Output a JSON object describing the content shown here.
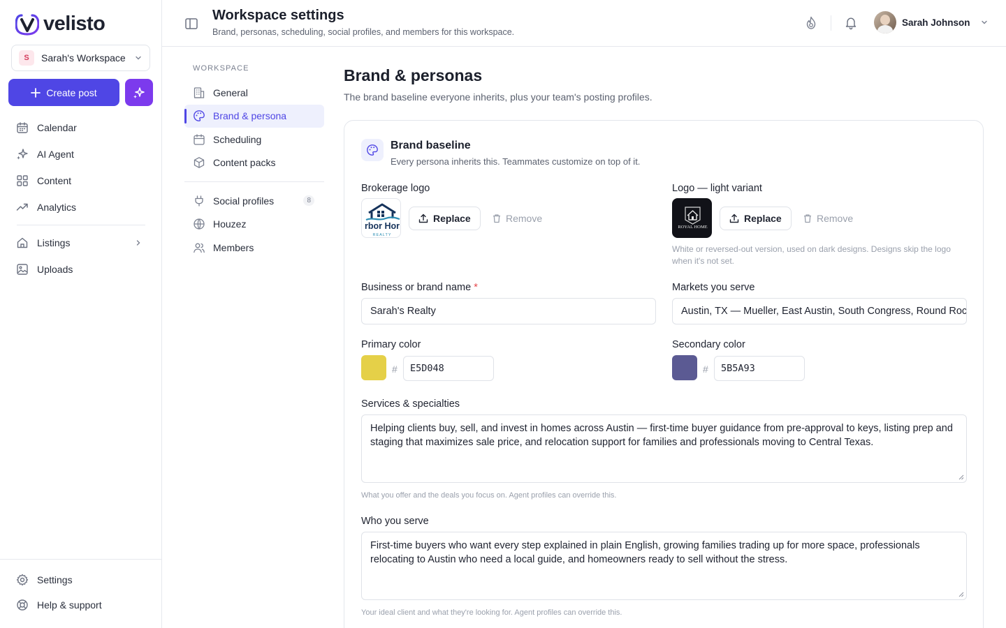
{
  "app": {
    "name": "velisto"
  },
  "workspace_switcher": {
    "initial": "S",
    "name": "Sarah's Workspace"
  },
  "actions": {
    "create_post": "Create post"
  },
  "nav": [
    {
      "label": "Calendar",
      "icon": "calendar-icon"
    },
    {
      "label": "AI Agent",
      "icon": "sparkles-icon"
    },
    {
      "label": "Content",
      "icon": "grid-icon"
    },
    {
      "label": "Analytics",
      "icon": "trend-icon"
    },
    {
      "label": "Listings",
      "icon": "home-icon"
    },
    {
      "label": "Uploads",
      "icon": "image-icon"
    }
  ],
  "nav_bottom": [
    {
      "label": "Settings",
      "icon": "gear-icon"
    },
    {
      "label": "Help & support",
      "icon": "lifebuoy-icon"
    }
  ],
  "header": {
    "title": "Workspace settings",
    "subtitle": "Brand, personas, scheduling, social profiles, and members for this workspace.",
    "user_name": "Sarah Johnson"
  },
  "subnav": {
    "heading": "WORKSPACE",
    "items": [
      {
        "label": "General",
        "icon": "building-icon"
      },
      {
        "label": "Brand & persona",
        "icon": "palette-icon",
        "active": true
      },
      {
        "label": "Scheduling",
        "icon": "calendar-icon"
      },
      {
        "label": "Content packs",
        "icon": "box-icon"
      }
    ],
    "items2": [
      {
        "label": "Social profiles",
        "icon": "plug-icon",
        "count": "8"
      },
      {
        "label": "Houzez",
        "icon": "globe-icon"
      },
      {
        "label": "Members",
        "icon": "users-icon"
      }
    ]
  },
  "main": {
    "title": "Brand & personas",
    "subtitle": "The brand baseline everyone inherits, plus your team's posting profiles."
  },
  "card": {
    "title": "Brand baseline",
    "subtitle": "Every persona inherits this. Teammates customize on top of it.",
    "brokerage_logo": {
      "label": "Brokerage logo",
      "replace": "Replace",
      "remove": "Remove",
      "logo_text": "rbor Hor",
      "logo_sub": "REALTY"
    },
    "light_logo": {
      "label": "Logo — light variant",
      "replace": "Replace",
      "remove": "Remove",
      "logo_text": "ROYAL HOME",
      "hint": "White or reversed-out version, used on dark designs. Designs skip the logo when it's not set."
    },
    "business_name": {
      "label": "Business or brand name",
      "required": "*",
      "value": "Sarah's Realty"
    },
    "markets": {
      "label": "Markets you serve",
      "value": "Austin, TX — Mueller, East Austin, South Congress, Round Rock"
    },
    "primary_color": {
      "label": "Primary color",
      "hash": "#",
      "hex": "E5D048",
      "color": "#E5D048"
    },
    "secondary_color": {
      "label": "Secondary color",
      "hash": "#",
      "hex": "5B5A93",
      "color": "#5B5A93"
    },
    "services": {
      "label": "Services & specialties",
      "value": "Helping clients buy, sell, and invest in homes across Austin — first-time buyer guidance from pre-approval to keys, listing prep and staging that maximizes sale price, and relocation support for families and professionals moving to Central Texas.",
      "hint": "What you offer and the deals you focus on. Agent profiles can override this."
    },
    "who": {
      "label": "Who you serve",
      "value": "First-time buyers who want every step explained in plain English, growing families trading up for more space, professionals relocating to Austin who need a local guide, and homeowners ready to sell without the stress.",
      "hint": "Your ideal client and what they're looking for. Agent profiles can override this."
    }
  },
  "colors": {
    "accent": "#4F46E5",
    "accent_magic": "#7C3AED"
  }
}
